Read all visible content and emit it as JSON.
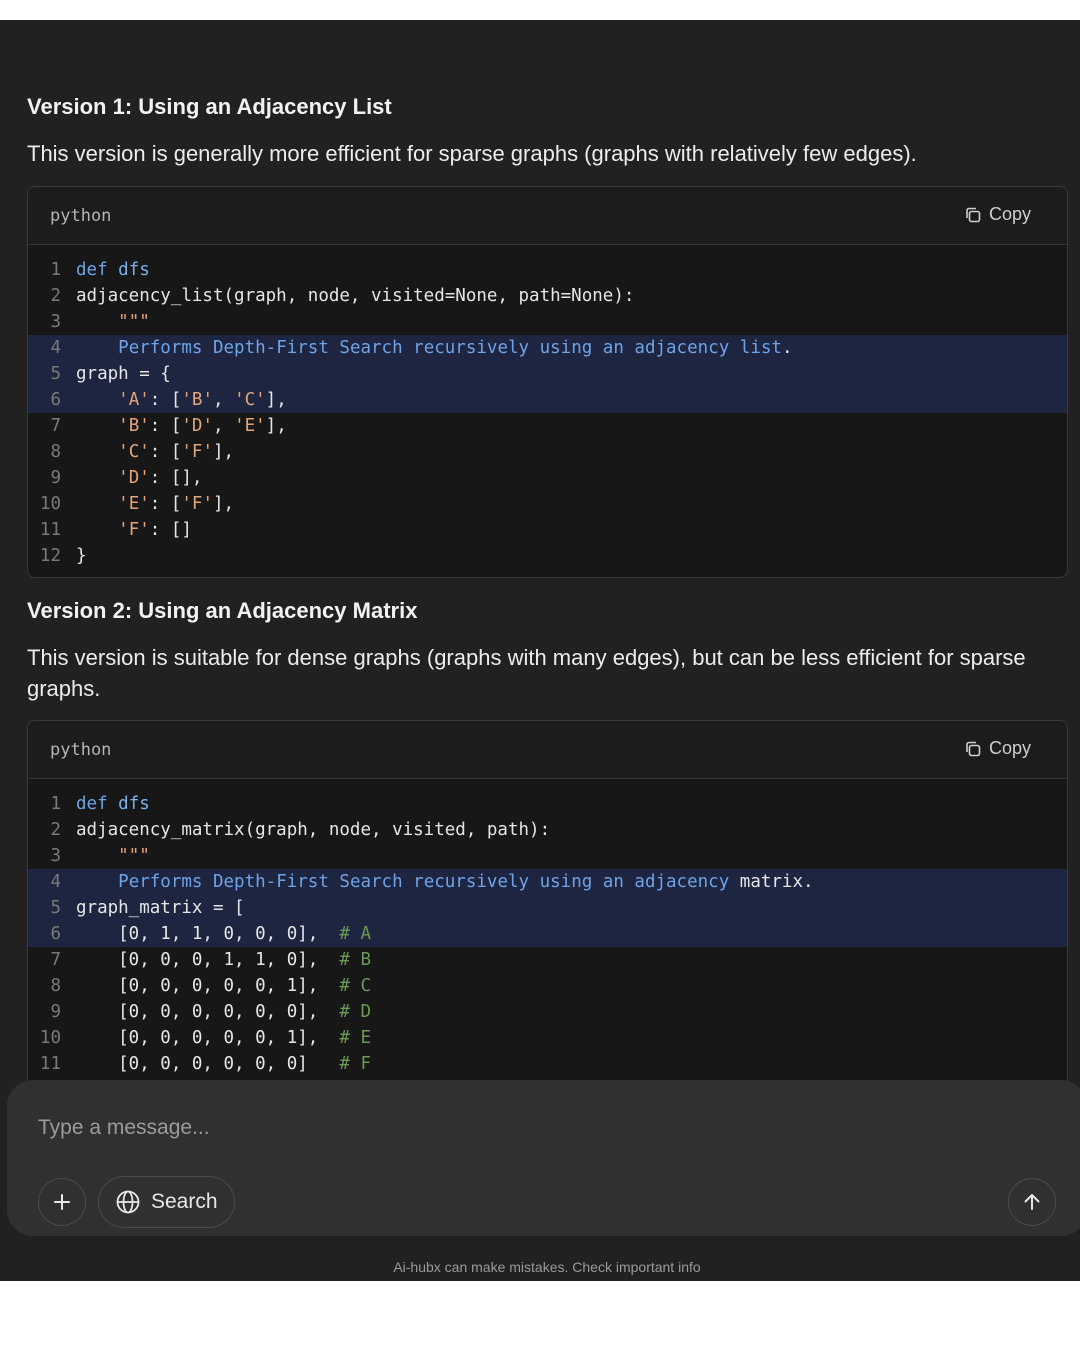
{
  "section1": {
    "heading": "Version 1: Using an Adjacency List",
    "description": "This version is generally more efficient for sparse graphs (graphs with relatively few edges).",
    "code": {
      "language": "python",
      "copy_label": "Copy",
      "lines": [
        {
          "n": "1",
          "text": "def dfs"
        },
        {
          "n": "2",
          "text": "adjacency_list(graph, node, visited=None, path=None):"
        },
        {
          "n": "3",
          "text": "    \"\"\""
        },
        {
          "n": "4",
          "text": "    Performs Depth-First Search recursively using an adjacency list."
        },
        {
          "n": "5",
          "text": "graph = {"
        },
        {
          "n": "6",
          "text": "    'A': ['B', 'C'],"
        },
        {
          "n": "7",
          "text": "    'B': ['D', 'E'],"
        },
        {
          "n": "8",
          "text": "    'C': ['F'],"
        },
        {
          "n": "9",
          "text": "    'D': [],"
        },
        {
          "n": "10",
          "text": "    'E': ['F'],"
        },
        {
          "n": "11",
          "text": "    'F': []"
        },
        {
          "n": "12",
          "text": "}"
        }
      ]
    }
  },
  "section2": {
    "heading": "Version 2: Using an Adjacency Matrix",
    "description": "This version is suitable for dense graphs (graphs with many edges), but can be less efficient for sparse graphs.",
    "code": {
      "language": "python",
      "copy_label": "Copy",
      "lines": [
        {
          "n": "1",
          "text": "def dfs"
        },
        {
          "n": "2",
          "text": "adjacency_matrix(graph, node, visited, path):"
        },
        {
          "n": "3",
          "text": "    \"\"\""
        },
        {
          "n": "4",
          "text": "    Performs Depth-First Search recursively using an adjacency matrix."
        },
        {
          "n": "5",
          "text": "graph_matrix = ["
        },
        {
          "n": "6",
          "text": "    [0, 1, 1, 0, 0, 0],  # A"
        },
        {
          "n": "7",
          "text": "    [0, 0, 0, 1, 1, 0],  # B"
        },
        {
          "n": "8",
          "text": "    [0, 0, 0, 0, 0, 1],  # C"
        },
        {
          "n": "9",
          "text": "    [0, 0, 0, 0, 0, 0],  # D"
        },
        {
          "n": "10",
          "text": "    [0, 0, 0, 0, 0, 1],  # E"
        },
        {
          "n": "11",
          "text": "    [0, 0, 0, 0, 0, 0]   # F"
        }
      ]
    }
  },
  "composer": {
    "placeholder": "Type a message...",
    "search_label": "Search",
    "plus_icon": "plus-icon",
    "globe_icon": "globe-icon",
    "send_icon": "arrow-up-icon"
  },
  "disclaimer": "Ai-hubx can make mistakes. Check important info",
  "colors": {
    "background": "#212121",
    "code_background": "#171717",
    "highlight": "#1d2540",
    "keyword": "#6fa3e8",
    "string": "#e4a57a",
    "comment": "#6a9955"
  }
}
